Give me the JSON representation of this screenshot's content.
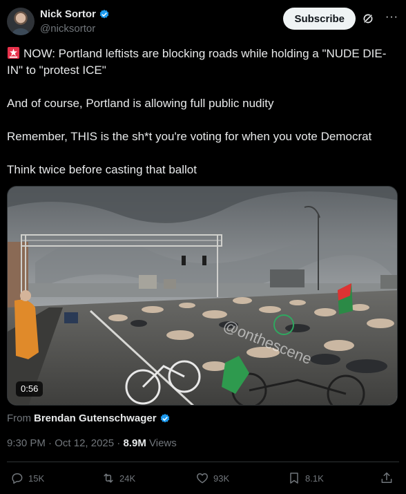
{
  "author": {
    "display_name": "Nick Sortor",
    "handle": "@nicksortor"
  },
  "header": {
    "subscribe_label": "Subscribe"
  },
  "post": {
    "lines": [
      "NOW: Portland leftists are blocking roads while holding a \"NUDE DIE-IN\" to \"protest ICE\"",
      "And of course, Portland is allowing full public nudity",
      "Remember, THIS is the sh*t you're voting for when you vote Democrat",
      "Think twice before casting that ballot"
    ]
  },
  "media": {
    "duration": "0:56",
    "watermark": "@onthescene"
  },
  "attribution": {
    "from_label": "From",
    "from_name": "Brendan Gutenschwager"
  },
  "meta": {
    "time": "9:30 PM",
    "date": "Oct 12, 2025",
    "views_count": "8.9M",
    "views_label": "Views"
  },
  "actions": {
    "replies": "15K",
    "reposts": "24K",
    "likes": "93K",
    "bookmarks": "8.1K"
  },
  "colors": {
    "background": "#000000",
    "text": "#e7e9ea",
    "secondary": "#71767b",
    "verified": "#1d9bf0"
  }
}
